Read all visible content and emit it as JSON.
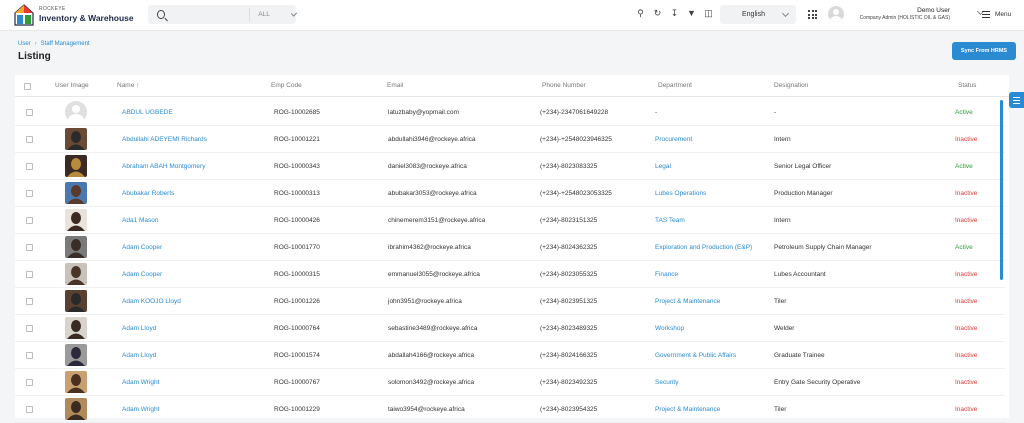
{
  "header": {
    "logo_small": "ROCKEYE",
    "logo_big": "Inventory & Warehouse",
    "search_placeholder": "",
    "search_filter": "ALL",
    "language": "English",
    "user_name": "Demo User",
    "user_role": "Company Admin (HOLISTIC OIL & GAS)",
    "menu_label": "Menu",
    "colors": {
      "accent": "#2a8bd3",
      "logo_navy": "#1d2a4a",
      "active": "#2e9e3a",
      "inactive": "#e53935"
    }
  },
  "breadcrumb": {
    "items": [
      "User",
      "Staff Management"
    ]
  },
  "page": {
    "title": "Listing",
    "sync_button": "Sync From HRMS"
  },
  "table": {
    "columns": [
      "User Image",
      "Name ↑",
      "Emp Code",
      "Email",
      "Phone Number",
      "Department",
      "Designation",
      "Status"
    ],
    "rows": [
      {
        "name": "ABDUL UGBEDE",
        "code": "ROG-10002685",
        "email": "latuzbaby@yopmail.com",
        "phone": "(+234)-2347061649228",
        "dept": "-",
        "desig": "-",
        "status": "Active",
        "avatar": [
          "#e0e0e0",
          "#cfcfcf"
        ],
        "placeholder": true
      },
      {
        "name": "Abdullahi ADEYEMI Richards",
        "code": "ROG-10001221",
        "email": "abdullahi3946@rockeye.africa",
        "phone": "(+234)-+2548023946325",
        "dept": "Procurement",
        "desig": "Intern",
        "status": "Inactive",
        "avatar": [
          "#6b4a35",
          "#2b2b2b"
        ]
      },
      {
        "name": "Abraham ABAH Montgomery",
        "code": "ROG-10000343",
        "email": "daniel3083@rockeye.africa",
        "phone": "(+234)-8023083325",
        "dept": "Legal",
        "desig": "Senior Legal Officer",
        "status": "Active",
        "avatar": [
          "#3a2a22",
          "#b88a3c"
        ]
      },
      {
        "name": "Abubakar Roberts",
        "code": "ROG-10000313",
        "email": "abubakar3053@rockeye.africa",
        "phone": "(+234)-+2548023053325",
        "dept": "Lubes Operations",
        "desig": "Production Manager",
        "status": "Inactive",
        "avatar": [
          "#4a78b0",
          "#5a3a2a"
        ]
      },
      {
        "name": "Ada1 Mason",
        "code": "ROG-10000426",
        "email": "chinemerem3151@rockeye.africa",
        "phone": "(+234)-8023151325",
        "dept": "TAS Team",
        "desig": "Intern",
        "status": "Inactive",
        "avatar": [
          "#e9e3dc",
          "#3a2a22"
        ]
      },
      {
        "name": "Adam Cooper",
        "code": "ROG-10001770",
        "email": "ibrahim4362@rockeye.africa",
        "phone": "(+234)-8024362325",
        "dept": "Exploration and Production (E&P)",
        "desig": "Petroleum Supply Chain Manager",
        "status": "Active",
        "avatar": [
          "#7a7a7a",
          "#3a2c26"
        ]
      },
      {
        "name": "Adam Cooper",
        "code": "ROG-10000315",
        "email": "emmanuel3055@rockeye.africa",
        "phone": "(+234)-8023055325",
        "dept": "Finance",
        "desig": "Lubes Accountant",
        "status": "Inactive",
        "avatar": [
          "#c8c2ba",
          "#4a3428"
        ]
      },
      {
        "name": "Adam KOOJO Lloyd",
        "code": "ROG-10001226",
        "email": "john3951@rockeye.africa",
        "phone": "(+234)-8023951325",
        "dept": "Project & Maintenance",
        "desig": "Tiler",
        "status": "Inactive",
        "avatar": [
          "#5a4030",
          "#2a2a2a"
        ]
      },
      {
        "name": "Adam Lloyd",
        "code": "ROG-10000764",
        "email": "sebastine3489@rockeye.africa",
        "phone": "(+234)-8023489325",
        "dept": "Workshop",
        "desig": "Welder",
        "status": "Inactive",
        "avatar": [
          "#d8d4cc",
          "#3a2a22"
        ]
      },
      {
        "name": "Adam Lloyd",
        "code": "ROG-10001574",
        "email": "abdallah4166@rockeye.africa",
        "phone": "(+234)-8024166325",
        "dept": "Government & Public Affairs",
        "desig": "Graduate Trainee",
        "status": "Inactive",
        "avatar": [
          "#9a9a9a",
          "#2a2a3a"
        ]
      },
      {
        "name": "Adam Wright",
        "code": "ROG-10000767",
        "email": "solomon3492@rockeye.africa",
        "phone": "(+234)-8023492325",
        "dept": "Security",
        "desig": "Entry Gate Security Operative",
        "status": "Inactive",
        "avatar": [
          "#c9a070",
          "#4a3020"
        ]
      },
      {
        "name": "Adam Wright",
        "code": "ROG-10001229",
        "email": "taiwo3954@rockeye.africa",
        "phone": "(+234)-8023954325",
        "dept": "Project & Maintenance",
        "desig": "Tiler",
        "status": "Inactive",
        "avatar": [
          "#b08a5a",
          "#3a2a20"
        ]
      }
    ]
  }
}
